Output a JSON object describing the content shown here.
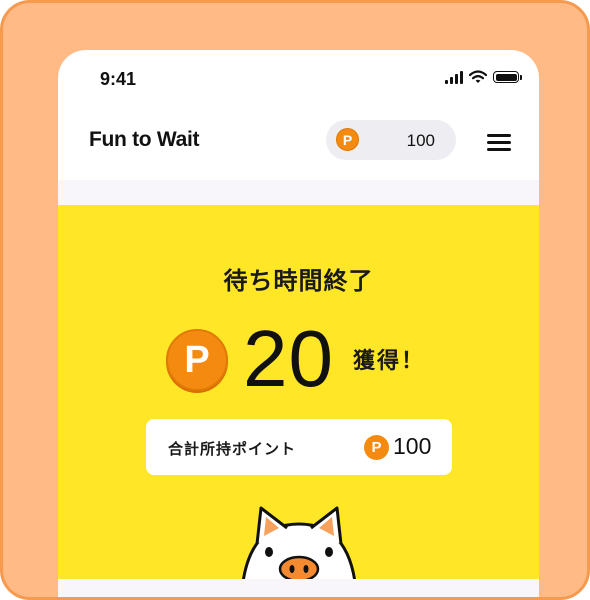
{
  "status_bar": {
    "time": "9:41",
    "signal_icon": "cellular-signal-icon",
    "wifi_icon": "wifi-icon",
    "battery_icon": "battery-icon"
  },
  "header": {
    "app_title": "Fun to Wait",
    "points_badge": {
      "icon_letter": "P",
      "value": "100"
    },
    "menu_icon": "hamburger-menu-icon"
  },
  "result": {
    "heading": "待ち時間終了",
    "icon_letter": "P",
    "earned_points": "20",
    "earned_label": "獲得！",
    "total_label": "合計所持ポイント",
    "total_value": "100",
    "mascot_icon": "pig-mascot-icon"
  },
  "colors": {
    "frame_bg": "#ffba85",
    "frame_border": "#f59a4e",
    "panel_yellow": "#ffe626",
    "coin_orange": "#f58a10",
    "text_dark": "#111111"
  }
}
